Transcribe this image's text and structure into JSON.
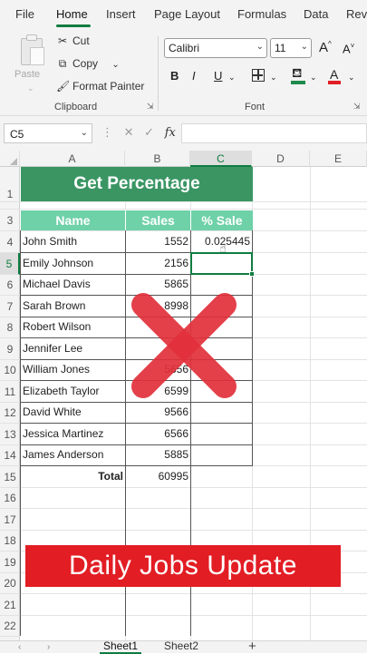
{
  "menu": {
    "tabs": [
      "File",
      "Home",
      "Insert",
      "Page Layout",
      "Formulas",
      "Data",
      "Revi"
    ],
    "active": "Home"
  },
  "ribbon": {
    "clipboard": {
      "paste_label": "Paste",
      "cut_label": "Cut",
      "copy_label": "Copy",
      "format_painter_label": "Format Painter",
      "group_label": "Clipboard"
    },
    "font": {
      "font_name": "Calibri",
      "font_size": "11",
      "grow_label": "A",
      "shrink_label": "A",
      "bold_label": "B",
      "italic_label": "I",
      "underline_label": "U",
      "font_color_label": "A",
      "group_label": "Font"
    }
  },
  "formula_bar": {
    "name_box": "C5",
    "fx_label": "fx",
    "formula": ""
  },
  "columns": [
    "A",
    "B",
    "C",
    "D",
    "E"
  ],
  "selected_column": "C",
  "rows": [
    "1",
    "2",
    "3",
    "4",
    "5",
    "6",
    "7",
    "8",
    "9",
    "10",
    "11",
    "12",
    "13",
    "14",
    "15",
    "16",
    "17",
    "18",
    "19",
    "20",
    "21",
    "22"
  ],
  "selected_row": "5",
  "sheet": {
    "title": "Get Percentage",
    "headers": [
      "Name",
      "Sales",
      "% Sale"
    ],
    "data": [
      {
        "name": "John Smith",
        "sales": "1552",
        "pct": "0.025445"
      },
      {
        "name": "Emily Johnson",
        "sales": "2156",
        "pct": ""
      },
      {
        "name": "Michael Davis",
        "sales": "5865",
        "pct": ""
      },
      {
        "name": "Sarah Brown",
        "sales": "8998",
        "pct": ""
      },
      {
        "name": "Robert Wilson",
        "sales": "",
        "pct": ""
      },
      {
        "name": "Jennifer Lee",
        "sales": "",
        "pct": ""
      },
      {
        "name": "William Jones",
        "sales": "5656",
        "pct": ""
      },
      {
        "name": "Elizabeth Taylor",
        "sales": "6599",
        "pct": ""
      },
      {
        "name": "David White",
        "sales": "9566",
        "pct": ""
      },
      {
        "name": "Jessica Martinez",
        "sales": "6566",
        "pct": ""
      },
      {
        "name": "James Anderson",
        "sales": "5885",
        "pct": ""
      }
    ],
    "total_label": "Total",
    "total_value": "60995"
  },
  "overlay": {
    "banner_text": "Daily Jobs Update",
    "x_color": "#e2303b",
    "banner_color": "#e21d24"
  },
  "sheet_tabs": [
    "Sheet1",
    "Sheet2"
  ],
  "active_sheet": "Sheet1",
  "colors": {
    "accent": "#107c41",
    "title_fill": "#3a9563",
    "header_fill": "#6fd1a8"
  }
}
